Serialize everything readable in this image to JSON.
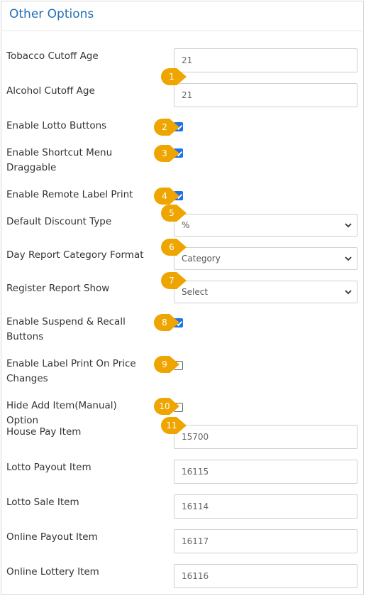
{
  "panel": {
    "title": "Other Options"
  },
  "rows": {
    "tobacco": {
      "label": "Tobacco Cutoff Age",
      "value": "21"
    },
    "alcohol": {
      "label": "Alcohol Cutoff Age",
      "value": "21"
    },
    "lotto_buttons": {
      "label": "Enable Lotto Buttons",
      "checked": true
    },
    "shortcut_menu": {
      "label": "Enable Shortcut Menu Draggable",
      "checked": true
    },
    "remote_label": {
      "label": "Enable Remote Label Print",
      "checked": true
    },
    "discount_type": {
      "label": "Default Discount Type",
      "value": "%"
    },
    "day_report": {
      "label": "Day Report Category Format",
      "value": "Category"
    },
    "register_report": {
      "label": "Register Report Show",
      "value": "Select"
    },
    "suspend_recall": {
      "label": "Enable Suspend & Recall Buttons",
      "checked": true
    },
    "label_price": {
      "label": "Enable Label Print On Price Changes",
      "checked": false
    },
    "hide_add_item": {
      "label": "Hide Add Item(Manual) Option",
      "checked": false
    },
    "house_pay": {
      "label": "House Pay Item",
      "value": "15700"
    },
    "lotto_payout": {
      "label": "Lotto Payout Item",
      "value": "16115"
    },
    "lotto_sale": {
      "label": "Lotto Sale Item",
      "value": "16114"
    },
    "online_payout": {
      "label": "Online Payout Item",
      "value": "16117"
    },
    "online_lottery": {
      "label": "Online Lottery Item",
      "value": "16116"
    }
  },
  "callouts": [
    "1",
    "2",
    "3",
    "4",
    "5",
    "6",
    "7",
    "8",
    "9",
    "10",
    "11"
  ],
  "colors": {
    "callout": "#efa500",
    "title": "#2470b8",
    "checkbox": "#1a73e8"
  }
}
